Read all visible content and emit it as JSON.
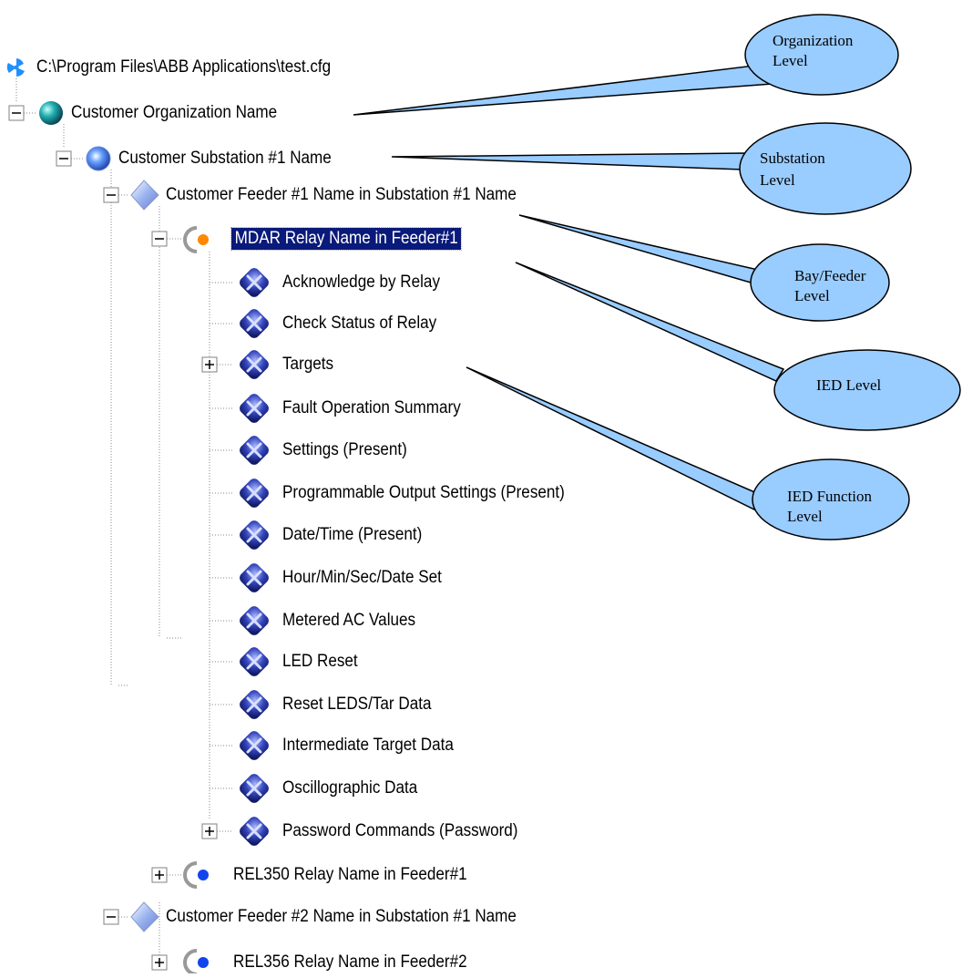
{
  "tree": {
    "root_path": "C:\\Program Files\\ABB Applications\\test.cfg",
    "organization": "Customer Organization Name",
    "substation": "Customer Substation #1 Name",
    "feeder1": "Customer Feeder #1 Name in Substation #1 Name",
    "relay_selected": "MDAR Relay Name in Feeder#1",
    "functions": [
      "Acknowledge by Relay",
      "Check Status of Relay",
      "Targets",
      "Fault Operation Summary",
      "Settings (Present)",
      "Programmable Output Settings (Present)",
      "Date/Time (Present)",
      "Hour/Min/Sec/Date Set",
      "Metered AC Values",
      "LED Reset",
      "Reset LEDS/Tar Data",
      "Intermediate Target Data",
      "Oscillographic Data",
      "Password Commands (Password)"
    ],
    "relay2": "REL350 Relay Name in Feeder#1",
    "feeder2": "Customer Feeder #2 Name in Substation #1 Name",
    "relay3": "REL356 Relay Name in Feeder#2"
  },
  "callouts": {
    "organization": [
      "Organization",
      "Level"
    ],
    "substation": [
      "Substation",
      "Level"
    ],
    "bay": [
      "Bay/Feeder",
      "Level"
    ],
    "ied": [
      "IED Level"
    ],
    "ied_function": [
      "IED Function",
      "Level"
    ]
  },
  "colors": {
    "selection_bg": "#0a1a7a",
    "callout_fill": "#99ccff",
    "function_icon": "#3344aa",
    "org_icon": "#22aaaa",
    "relay_dot_orange": "#ff8800",
    "relay_dot_blue": "#1144ee"
  }
}
